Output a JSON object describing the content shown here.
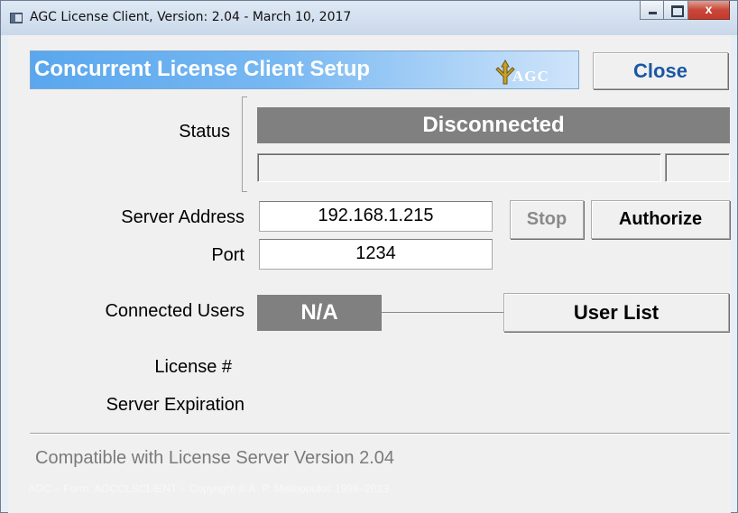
{
  "window": {
    "title": "AGC License Client, Version: 2.04 - March 10, 2017",
    "close_glyph": "x"
  },
  "header": {
    "title": "Concurrent License Client Setup",
    "logo_text": "AGC",
    "close_label": "Close",
    "banner_color": "#5aa7ee"
  },
  "status": {
    "label": "Status",
    "value": "Disconnected",
    "detail": "",
    "detail_extra": ""
  },
  "server": {
    "address_label": "Server Address",
    "address_value": "192.168.1.215",
    "port_label": "Port",
    "port_value": "1234",
    "stop_label": "Stop",
    "authorize_label": "Authorize"
  },
  "users": {
    "label": "Connected Users",
    "value": "N/A",
    "user_list_label": "User List"
  },
  "license": {
    "number_label": "License #",
    "number_value": "",
    "expiration_label": "Server Expiration",
    "expiration_value": ""
  },
  "footer": {
    "compat_text": "Compatible with License Server Version 2.04",
    "copyright": "AGC – Form: AGCCLSCLIENT – Copyright © A. P. Meliopoulos 1998–2013"
  },
  "colors": {
    "panel_gray": "#808080",
    "close_text": "#1a57a5",
    "window_bg": "#f0f0f0"
  },
  "icons": [
    "app-icon",
    "minimize-icon",
    "maximize-icon",
    "close-icon",
    "agc-logo"
  ]
}
